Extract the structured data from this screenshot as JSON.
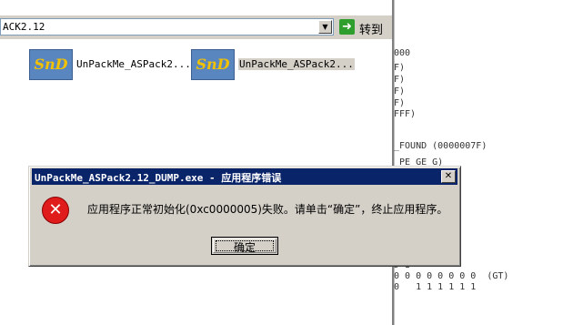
{
  "explorer": {
    "address": "ACK2.12",
    "go_label": "转到",
    "files": [
      {
        "name": "UnPackMe_ASPack2...",
        "icon": "SnD"
      },
      {
        "name": "UnPackMe_ASPack2...",
        "icon": "SnD"
      }
    ]
  },
  "debugger": {
    "lines": [
      "000",
      "F)",
      "F)",
      "F)",
      "F)",
      "FFF)",
      "_FOUND (0000007F)",
      "_PE GE G)",
      "D I",
      "0 0 0 0 0 0 0 0  (GT)",
      "0   1 1 1 1 1 1"
    ]
  },
  "dialog": {
    "title": "UnPackMe_ASPack2.12_DUMP.exe - 应用程序错误",
    "message": "应用程序正常初始化(0xc0000005)失败。请单击“确定”，终止应用程序。",
    "ok_label": "确定",
    "close_glyph": "✕",
    "error_glyph": "✕"
  }
}
